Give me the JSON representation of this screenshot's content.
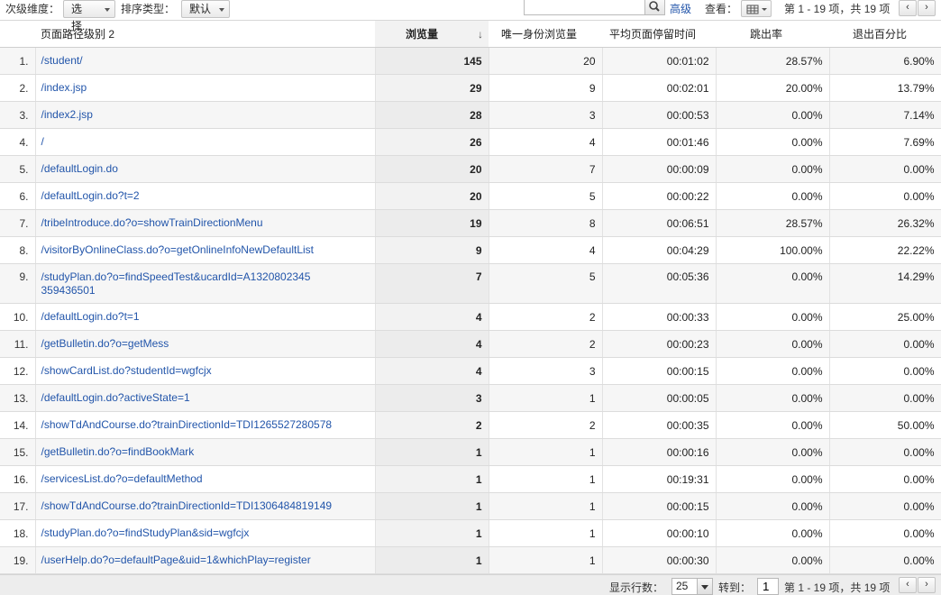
{
  "toolbar": {
    "secondary_dimension_label": "次级维度：",
    "secondary_dimension_value": "选择...",
    "sort_type_label": "排序类型：",
    "sort_type_value": "默认",
    "search_placeholder": "",
    "advanced_label": "高级",
    "view_label": "查看：",
    "pager_text": "第 1 - 19 项，共 19 项",
    "prev_icon": "chevron-left-icon",
    "next_icon": "chevron-right-icon"
  },
  "table": {
    "headers": {
      "path": "页面路径级别 2",
      "views": "浏览量",
      "unique_views": "唯一身份浏览量",
      "avg_time": "平均页面停留时间",
      "bounce": "跳出率",
      "exit": "退出百分比"
    },
    "sort_icon": "arrow-down-icon",
    "rows": [
      {
        "idx": "1.",
        "path": "/student/",
        "views": "145",
        "unique": "20",
        "time": "00:01:02",
        "bounce": "28.57%",
        "exit": "6.90%"
      },
      {
        "idx": "2.",
        "path": "/index.jsp",
        "views": "29",
        "unique": "9",
        "time": "00:02:01",
        "bounce": "20.00%",
        "exit": "13.79%"
      },
      {
        "idx": "3.",
        "path": "/index2.jsp",
        "views": "28",
        "unique": "3",
        "time": "00:00:53",
        "bounce": "0.00%",
        "exit": "7.14%"
      },
      {
        "idx": "4.",
        "path": "/",
        "views": "26",
        "unique": "4",
        "time": "00:01:46",
        "bounce": "0.00%",
        "exit": "7.69%"
      },
      {
        "idx": "5.",
        "path": "/defaultLogin.do",
        "views": "20",
        "unique": "7",
        "time": "00:00:09",
        "bounce": "0.00%",
        "exit": "0.00%"
      },
      {
        "idx": "6.",
        "path": "/defaultLogin.do?t=2",
        "views": "20",
        "unique": "5",
        "time": "00:00:22",
        "bounce": "0.00%",
        "exit": "0.00%"
      },
      {
        "idx": "7.",
        "path": "/tribeIntroduce.do?o=showTrainDirectionMenu",
        "views": "19",
        "unique": "8",
        "time": "00:06:51",
        "bounce": "28.57%",
        "exit": "26.32%"
      },
      {
        "idx": "8.",
        "path": "/visitorByOnlineClass.do?o=getOnlineInfoNewDefaultList",
        "views": "9",
        "unique": "4",
        "time": "00:04:29",
        "bounce": "100.00%",
        "exit": "22.22%"
      },
      {
        "idx": "9.",
        "path": "/studyPlan.do?o=findSpeedTest&ucardId=A1320802345359436501",
        "views": "7",
        "unique": "5",
        "time": "00:05:36",
        "bounce": "0.00%",
        "exit": "14.29%"
      },
      {
        "idx": "10.",
        "path": "/defaultLogin.do?t=1",
        "views": "4",
        "unique": "2",
        "time": "00:00:33",
        "bounce": "0.00%",
        "exit": "25.00%"
      },
      {
        "idx": "11.",
        "path": "/getBulletin.do?o=getMess",
        "views": "4",
        "unique": "2",
        "time": "00:00:23",
        "bounce": "0.00%",
        "exit": "0.00%"
      },
      {
        "idx": "12.",
        "path": "/showCardList.do?studentId=wgfcjx",
        "views": "4",
        "unique": "3",
        "time": "00:00:15",
        "bounce": "0.00%",
        "exit": "0.00%"
      },
      {
        "idx": "13.",
        "path": "/defaultLogin.do?activeState=1",
        "views": "3",
        "unique": "1",
        "time": "00:00:05",
        "bounce": "0.00%",
        "exit": "0.00%"
      },
      {
        "idx": "14.",
        "path": "/showTdAndCourse.do?trainDirectionId=TDI1265527280578",
        "views": "2",
        "unique": "2",
        "time": "00:00:35",
        "bounce": "0.00%",
        "exit": "50.00%"
      },
      {
        "idx": "15.",
        "path": "/getBulletin.do?o=findBookMark",
        "views": "1",
        "unique": "1",
        "time": "00:00:16",
        "bounce": "0.00%",
        "exit": "0.00%"
      },
      {
        "idx": "16.",
        "path": "/servicesList.do?o=defaultMethod",
        "views": "1",
        "unique": "1",
        "time": "00:19:31",
        "bounce": "0.00%",
        "exit": "0.00%"
      },
      {
        "idx": "17.",
        "path": "/showTdAndCourse.do?trainDirectionId=TDI1306484819149",
        "views": "1",
        "unique": "1",
        "time": "00:00:15",
        "bounce": "0.00%",
        "exit": "0.00%"
      },
      {
        "idx": "18.",
        "path": "/studyPlan.do?o=findStudyPlan&sid=wgfcjx",
        "views": "1",
        "unique": "1",
        "time": "00:00:10",
        "bounce": "0.00%",
        "exit": "0.00%"
      },
      {
        "idx": "19.",
        "path": "/userHelp.do?o=defaultPage&uid=1&whichPlay=register",
        "views": "1",
        "unique": "1",
        "time": "00:00:30",
        "bounce": "0.00%",
        "exit": "0.00%"
      }
    ]
  },
  "footer": {
    "rows_label": "显示行数：",
    "rows_value": "25",
    "goto_label": "转到：",
    "goto_value": "1",
    "pager_text": "第 1 - 19 项，共 19 项"
  }
}
